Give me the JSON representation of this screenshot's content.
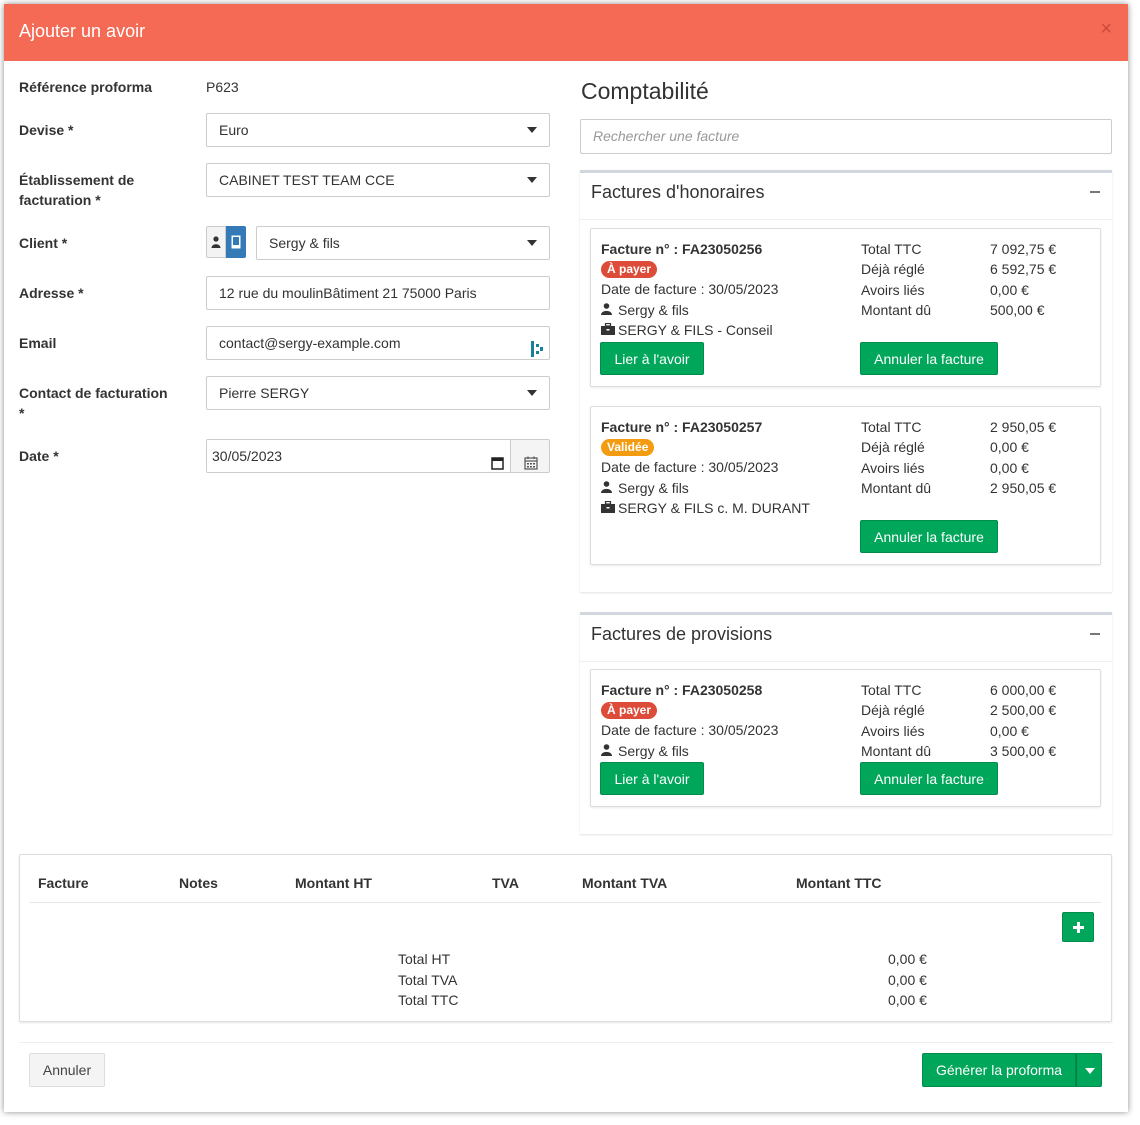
{
  "modal": {
    "title": "Ajouter un avoir",
    "close_glyph": "×"
  },
  "form": {
    "ref_label": "Référence proforma",
    "ref_value": "P623",
    "devise_label": "Devise *",
    "devise_value": "Euro",
    "etab_label_line1": "Établissement de",
    "etab_label_line2": "facturation *",
    "etab_value": "CABINET TEST TEAM CCE",
    "client_label": "Client *",
    "client_value": "Sergy & fils",
    "adresse_label": "Adresse *",
    "adresse_value": "12 rue du moulinBâtiment 21 75000 Paris",
    "email_label": "Email",
    "email_value": "contact@sergy-example.com",
    "contact_label_line1": "Contact de facturation",
    "contact_label_line2": "*",
    "contact_value": "Pierre SERGY",
    "date_label": "Date *",
    "date_value": "30/05/2023"
  },
  "compta": {
    "title": "Comptabilité",
    "search_placeholder": "Rechercher une facture",
    "honoraires": {
      "title": "Factures d'honoraires",
      "invoices": [
        {
          "title": "Facture n° : FA23050256",
          "badge": "À payer",
          "date": "Date de facture : 30/05/2023",
          "client": "Sergy & fils",
          "mission": "SERGY & FILS - Conseil",
          "labels": [
            "Total TTC",
            "Déjà réglé",
            "Avoirs liés",
            "Montant dû"
          ],
          "values": [
            "7 092,75 €",
            "6 592,75 €",
            "0,00 €",
            "500,00 €"
          ],
          "link_label": "Lier à l'avoir",
          "cancel_label": "Annuler la facture"
        },
        {
          "title": "Facture n° : FA23050257",
          "badge": "Validée",
          "date": "Date de facture : 30/05/2023",
          "client": "Sergy & fils",
          "mission": "SERGY & FILS c. M. DURANT",
          "labels": [
            "Total TTC",
            "Déjà réglé",
            "Avoirs liés",
            "Montant dû"
          ],
          "values": [
            "2 950,05 €",
            "0,00 €",
            "0,00 €",
            "2 950,05 €"
          ],
          "cancel_label": "Annuler la facture"
        }
      ]
    },
    "provisions": {
      "title": "Factures de provisions",
      "invoices": [
        {
          "title": "Facture n° : FA23050258",
          "badge": "À payer",
          "date": "Date de facture : 30/05/2023",
          "client": "Sergy & fils",
          "labels": [
            "Total TTC",
            "Déjà réglé",
            "Avoirs liés",
            "Montant dû"
          ],
          "values": [
            "6 000,00 €",
            "2 500,00 €",
            "0,00 €",
            "3 500,00 €"
          ],
          "link_label": "Lier à l'avoir",
          "cancel_label": "Annuler la facture"
        }
      ]
    }
  },
  "table": {
    "headers": [
      "Facture",
      "Notes",
      "Montant HT",
      "TVA",
      "Montant TVA",
      "Montant TTC"
    ],
    "totals_labels": [
      "Total HT",
      "Total TVA",
      "Total TTC"
    ],
    "totals_values": [
      "0,00 €",
      "0,00 €",
      "0,00 €"
    ]
  },
  "footer": {
    "cancel_label": "Annuler",
    "generate_label": "Générer la proforma"
  },
  "colors": {
    "header": "#f46a55",
    "green": "#00a65a",
    "red_badge": "#dd4b39",
    "orange_badge": "#f39c12",
    "blue": "#337ab7"
  }
}
